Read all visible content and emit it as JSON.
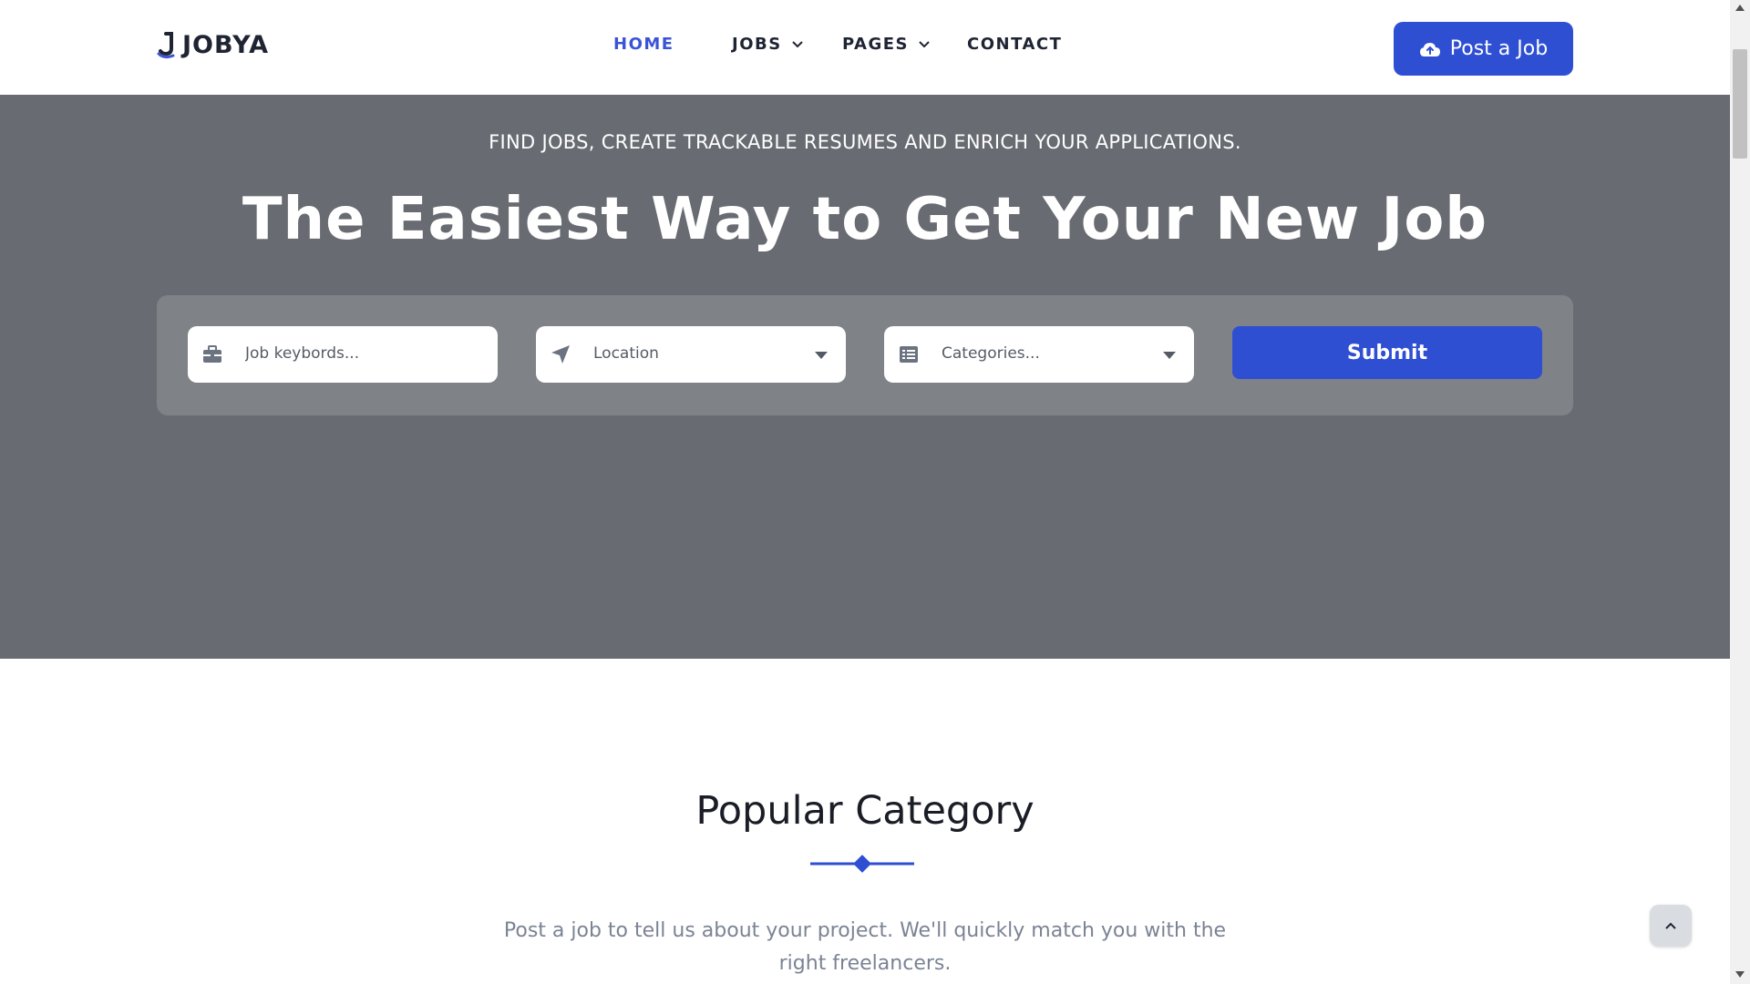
{
  "brand": {
    "name": "JOBYA"
  },
  "nav": {
    "items": [
      {
        "label": "HOME",
        "active": true
      },
      {
        "label": "JOBS",
        "dropdown": true
      },
      {
        "label": "PAGES",
        "dropdown": true
      },
      {
        "label": "CONTACT"
      }
    ]
  },
  "header": {
    "post_job_label": "Post a Job"
  },
  "hero": {
    "tagline": "FIND JOBS, CREATE TRACKABLE RESUMES AND ENRICH YOUR APPLICATIONS.",
    "title": "The Easiest Way to Get Your New Job"
  },
  "search": {
    "keywords_placeholder": "Job keybords...",
    "location_value": "Location",
    "categories_value": "Categories...",
    "submit_label": "Submit"
  },
  "category_section": {
    "title": "Popular Category",
    "description": "Post a job to tell us about your project. We'll quickly match you with the right freelancers."
  },
  "colors": {
    "accent": "#2f4fd3",
    "hero_bg": "#686b71",
    "panel_bg": "#7f8287"
  },
  "icons": [
    "briefcase-icon",
    "location-arrow-icon",
    "list-icon",
    "cloud-upload-icon",
    "chevron-down-icon",
    "chevron-up-icon"
  ]
}
